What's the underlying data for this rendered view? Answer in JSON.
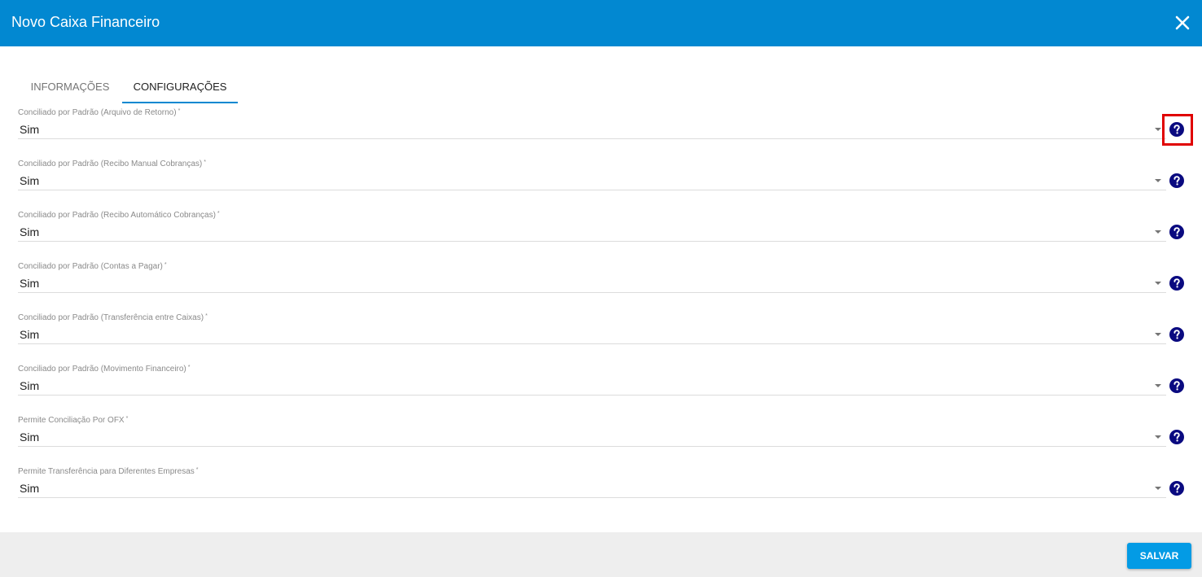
{
  "dialog": {
    "title": "Novo Caixa Financeiro",
    "header_color": "#0288d1",
    "close_icon": "close-icon"
  },
  "tabs": [
    {
      "label": "INFORMAÇÕES",
      "active": false
    },
    {
      "label": "CONFIGURAÇÕES",
      "active": true
    }
  ],
  "fields": [
    {
      "label": "Conciliado por Padrão (Arquivo de Retorno)",
      "required_mark": "*",
      "value": "Sim",
      "help_icon": "question-circle-icon"
    },
    {
      "label": "Conciliado por Padrão (Recibo Manual Cobranças)",
      "required_mark": "*",
      "value": "Sim",
      "help_icon": "question-circle-icon"
    },
    {
      "label": "Conciliado por Padrão (Recibo Automático Cobranças)",
      "required_mark": "*",
      "value": "Sim",
      "help_icon": "question-circle-icon"
    },
    {
      "label": "Conciliado por Padrão (Contas a Pagar)",
      "required_mark": "*",
      "value": "Sim",
      "help_icon": "question-circle-icon"
    },
    {
      "label": "Conciliado por Padrão (Transferência entre Caixas)",
      "required_mark": "*",
      "value": "Sim",
      "help_icon": "question-circle-icon"
    },
    {
      "label": "Conciliado por Padrão (Movimento Financeiro)",
      "required_mark": "*",
      "value": "Sim",
      "help_icon": "question-circle-icon"
    },
    {
      "label": "Permite Conciliação Por OFX",
      "required_mark": "*",
      "value": "Sim",
      "help_icon": "question-circle-icon"
    },
    {
      "label": "Permite Transferência para Diferentes Empresas",
      "required_mark": "*",
      "value": "Sim",
      "help_icon": "question-circle-icon"
    }
  ],
  "footer": {
    "save_label": "SALVAR",
    "save_color": "#039be5"
  },
  "highlight_color": "#e00000",
  "help_icon_color": "#0a0a80"
}
